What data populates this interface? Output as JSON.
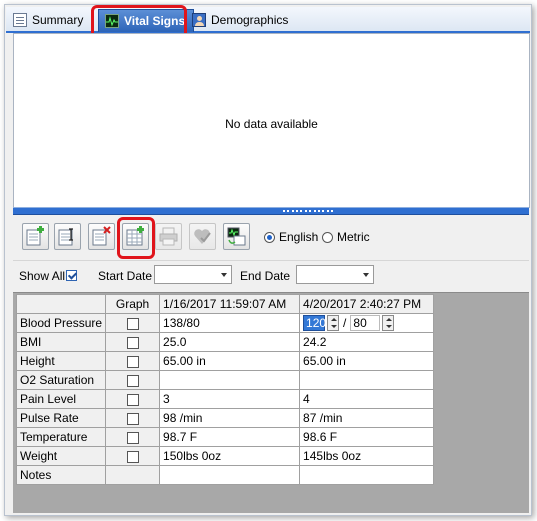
{
  "tabs": [
    {
      "label": "Summary",
      "icon": "document-icon",
      "active": false
    },
    {
      "label": "Vital Signs",
      "icon": "heart-monitor-icon",
      "active": true
    },
    {
      "label": "Demographics",
      "icon": "person-icon",
      "active": false
    }
  ],
  "chart_panel": {
    "message": "No data available"
  },
  "toolbar": {
    "buttons": [
      {
        "icon": "add-vitals-icon",
        "enabled": true
      },
      {
        "icon": "edit-vitals-icon",
        "enabled": true
      },
      {
        "icon": "delete-vitals-icon",
        "enabled": true
      },
      {
        "icon": "add-column-icon",
        "enabled": true,
        "highlighted": true
      },
      {
        "icon": "print-icon",
        "enabled": false
      },
      {
        "icon": "heart-check-icon",
        "enabled": false
      },
      {
        "icon": "import-vitals-icon",
        "enabled": true
      }
    ],
    "units": {
      "english_label": "English",
      "metric_label": "Metric",
      "selected": "English"
    }
  },
  "filter": {
    "show_all_label": "Show All",
    "show_all_checked": true,
    "start_date_label": "Start Date",
    "start_date_value": "",
    "end_date_label": "End Date",
    "end_date_value": ""
  },
  "grid": {
    "graph_header": "Graph",
    "columns": [
      "1/16/2017 11:59:07 AM",
      "4/20/2017 2:40:27 PM"
    ],
    "rows": [
      {
        "label": "Blood Pressure",
        "values": [
          "138/80",
          ""
        ],
        "bp_systolic": "120",
        "bp_diastolic": "80",
        "bp_separator": "/"
      },
      {
        "label": "BMI",
        "values": [
          "25.0",
          "24.2"
        ]
      },
      {
        "label": "Height",
        "values": [
          "65.00 in",
          "65.00 in"
        ]
      },
      {
        "label": "O2 Saturation",
        "values": [
          "",
          ""
        ]
      },
      {
        "label": "Pain Level",
        "values": [
          "3",
          "4"
        ]
      },
      {
        "label": "Pulse Rate",
        "values": [
          "98 /min",
          "87 /min"
        ]
      },
      {
        "label": "Temperature",
        "values": [
          "98.7 F",
          "98.6 F"
        ]
      },
      {
        "label": "Weight",
        "values": [
          "150lbs 0oz",
          "145lbs 0oz"
        ]
      },
      {
        "label": "Notes",
        "values": [
          "",
          ""
        ]
      }
    ]
  },
  "colors": {
    "accent": "#2f6fd1",
    "highlight": "#e0141b",
    "selection": "#3378d6"
  }
}
